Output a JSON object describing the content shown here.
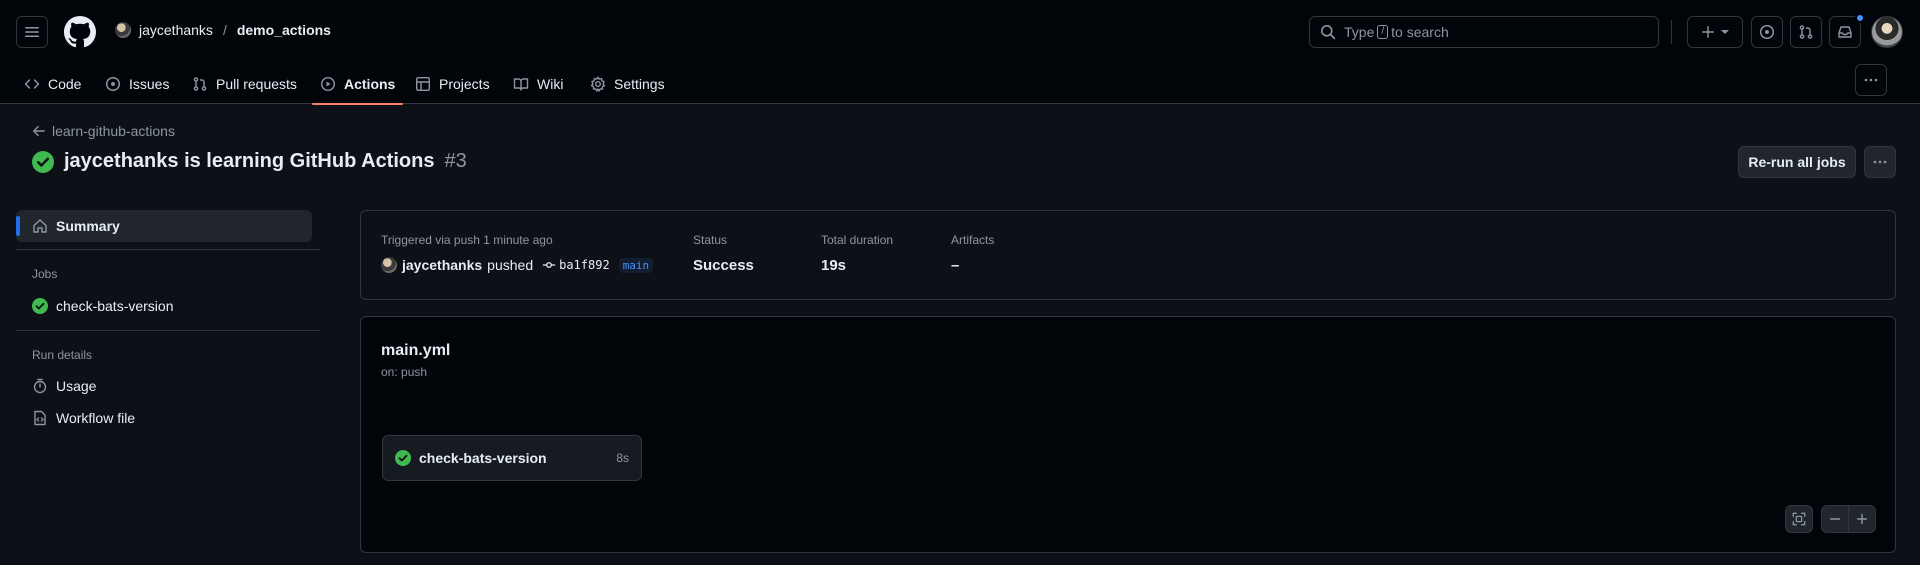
{
  "header": {
    "owner": "jaycethanks",
    "separator": "/",
    "repo": "demo_actions",
    "search": {
      "prefix": "Type",
      "key": "/",
      "suffix": "to search"
    }
  },
  "tabs": [
    {
      "label": "Code",
      "icon": "code-icon"
    },
    {
      "label": "Issues",
      "icon": "issue-opened-icon"
    },
    {
      "label": "Pull requests",
      "icon": "git-pull-request-icon"
    },
    {
      "label": "Actions",
      "icon": "play-icon",
      "active": true
    },
    {
      "label": "Projects",
      "icon": "table-icon"
    },
    {
      "label": "Wiki",
      "icon": "book-icon"
    },
    {
      "label": "Settings",
      "icon": "gear-icon"
    }
  ],
  "run": {
    "back_label": "learn-github-actions",
    "title": "jaycethanks is learning GitHub Actions",
    "number": "#3",
    "rerun_label": "Re-run all jobs"
  },
  "sidebar": {
    "summary_label": "Summary",
    "jobs_heading": "Jobs",
    "job_label": "check-bats-version",
    "run_details_heading": "Run details",
    "usage_label": "Usage",
    "workflow_file_label": "Workflow file"
  },
  "summary": {
    "trigger_text": "Triggered via push 1 minute ago",
    "actor": "jaycethanks",
    "action": "pushed",
    "sha": "ba1f892",
    "branch": "main",
    "status_label": "Status",
    "status_value": "Success",
    "duration_label": "Total duration",
    "duration_value": "19s",
    "artifacts_label": "Artifacts",
    "artifacts_value": "–"
  },
  "workflow": {
    "file": "main.yml",
    "trigger": "on: push",
    "job_name": "check-bats-version",
    "job_duration": "8s"
  },
  "colors": {
    "success": "#3fb950",
    "accent": "#f78166",
    "selection": "#1f6feb",
    "notification": "#4493f8"
  }
}
